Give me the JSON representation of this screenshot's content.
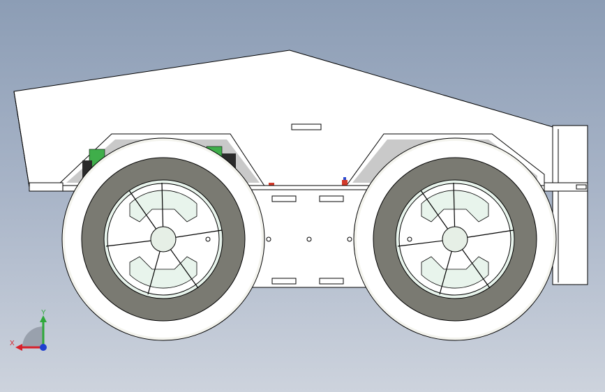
{
  "viewport": {
    "background_top": "#8c9db5",
    "background_bottom": "#cdd3dd"
  },
  "model": {
    "body_color": "#ffffff",
    "edge_color": "#000000",
    "tire_color": "#f4f4ee",
    "rim_color": "#7a7a72",
    "hub_color": "#e6efe6",
    "board_color": "#3fae4a",
    "connector_color": "#d23a2a"
  },
  "triad": {
    "x_label": "X",
    "y_label": "Y",
    "x_color": "#d8202a",
    "y_color": "#2ea83a",
    "z_color": "#1f3fd0",
    "x_icon": "x-axis-arrow-icon",
    "y_icon": "y-axis-arrow-icon",
    "z_icon": "z-axis-origin-icon"
  }
}
